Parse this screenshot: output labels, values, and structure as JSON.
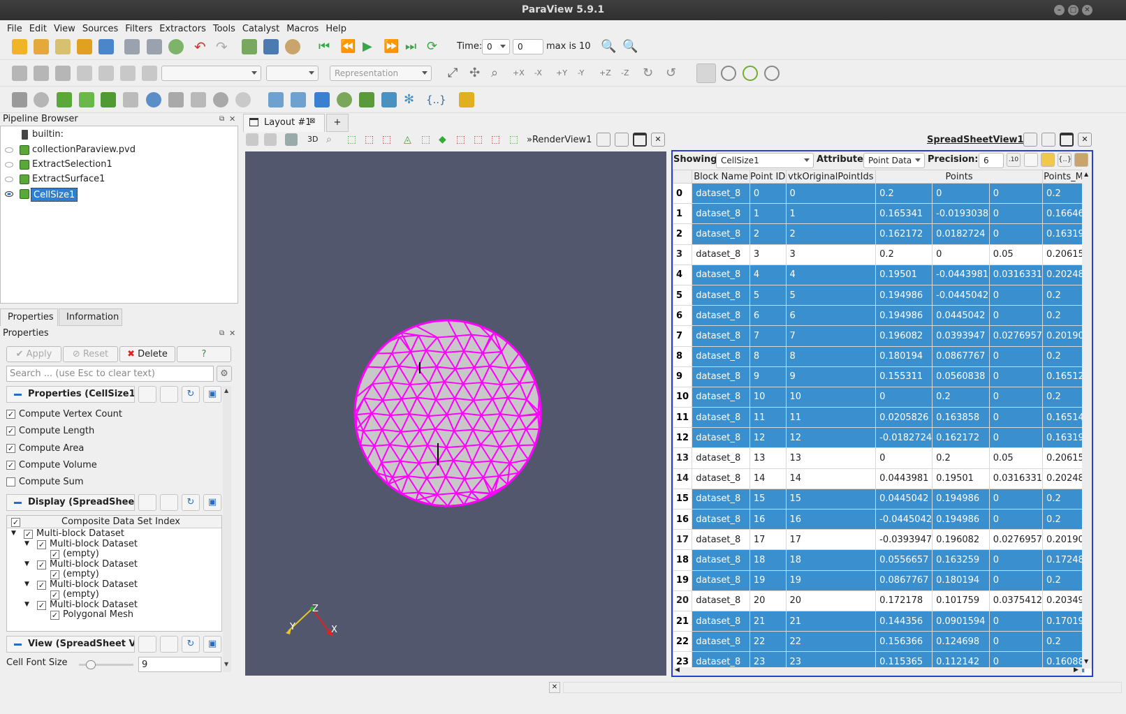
{
  "window": {
    "title": "ParaView 5.9.1"
  },
  "menu": [
    "File",
    "Edit",
    "View",
    "Sources",
    "Filters",
    "Extractors",
    "Tools",
    "Catalyst",
    "Macros",
    "Help"
  ],
  "time": {
    "label": "Time:",
    "value": "0",
    "index": "0",
    "max": "max is 10"
  },
  "toolbar2": {
    "representation": "Representation"
  },
  "pipeline": {
    "title": "Pipeline Browser",
    "items": [
      "builtin:",
      "collectionParaview.pvd",
      "ExtractSelection1",
      "ExtractSurface1",
      "CellSize1"
    ]
  },
  "tabs": {
    "properties": "Properties",
    "information": "Information"
  },
  "properties": {
    "header": "Properties",
    "apply": "Apply",
    "reset": "Reset",
    "delete": "Delete",
    "help": "?",
    "search_placeholder": "Search ... (use Esc to clear text)",
    "section1": "Properties (CellSize1)",
    "checks": [
      {
        "label": "Compute Vertex Count",
        "checked": true
      },
      {
        "label": "Compute Length",
        "checked": true
      },
      {
        "label": "Compute Area",
        "checked": true
      },
      {
        "label": "Compute Volume",
        "checked": true
      },
      {
        "label": "Compute Sum",
        "checked": false
      }
    ],
    "section2": "Display (SpreadSheet",
    "tree_header": "Composite Data Set Index",
    "tree": [
      "Multi-block Dataset",
      "Multi-block Dataset",
      "(empty)",
      "Multi-block Dataset",
      "(empty)",
      "Multi-block Dataset",
      "(empty)",
      "Multi-block Dataset",
      "Polygonal Mesh"
    ],
    "section3": "View (SpreadSheet Vi",
    "font_size_label": "Cell Font Size",
    "font_size_value": "9",
    "font_slider_fraction": 0.15
  },
  "layout": {
    "tab": "Layout #1",
    "add": "+",
    "render_view": "RenderView1",
    "mode3d": "3D",
    "spreadsheet_view": "SpreadSheetView1"
  },
  "spreadsheet": {
    "showing_label": "Showing",
    "showing_value": "CellSize1",
    "attribute_label": "Attribute:",
    "attribute_value": "Point Data",
    "precision_label": "Precision:",
    "precision_value": "6",
    "columns": [
      "Block Name",
      "Point ID",
      "vtkOriginalPointIds",
      "Points",
      "Points_M"
    ],
    "rows": [
      [
        "0",
        "dataset_8",
        "0",
        "0",
        "0.2",
        "0",
        "0",
        "0.2",
        true
      ],
      [
        "1",
        "dataset_8",
        "1",
        "1",
        "0.165341",
        "-0.0193038",
        "0",
        "0.16646",
        true
      ],
      [
        "2",
        "dataset_8",
        "2",
        "2",
        "0.162172",
        "0.0182724",
        "0",
        "0.16319",
        true
      ],
      [
        "3",
        "dataset_8",
        "3",
        "3",
        "0.2",
        "0",
        "0.05",
        "0.20615",
        false
      ],
      [
        "4",
        "dataset_8",
        "4",
        "4",
        "0.19501",
        "-0.0443981",
        "0.0316331",
        "0.20248",
        true
      ],
      [
        "5",
        "dataset_8",
        "5",
        "5",
        "0.194986",
        "-0.0445042",
        "0",
        "0.2",
        true
      ],
      [
        "6",
        "dataset_8",
        "6",
        "6",
        "0.194986",
        "0.0445042",
        "0",
        "0.2",
        true
      ],
      [
        "7",
        "dataset_8",
        "7",
        "7",
        "0.196082",
        "0.0393947",
        "0.0276957",
        "0.20190",
        true
      ],
      [
        "8",
        "dataset_8",
        "8",
        "8",
        "0.180194",
        "0.0867767",
        "0",
        "0.2",
        true
      ],
      [
        "9",
        "dataset_8",
        "9",
        "9",
        "0.155311",
        "0.0560838",
        "0",
        "0.16512",
        true
      ],
      [
        "10",
        "dataset_8",
        "10",
        "10",
        "0",
        "0.2",
        "0",
        "0.2",
        true
      ],
      [
        "11",
        "dataset_8",
        "11",
        "11",
        "0.0205826",
        "0.163858",
        "0",
        "0.16514",
        true
      ],
      [
        "12",
        "dataset_8",
        "12",
        "12",
        "-0.0182724",
        "0.162172",
        "0",
        "0.16319",
        true
      ],
      [
        "13",
        "dataset_8",
        "13",
        "13",
        "0",
        "0.2",
        "0.05",
        "0.20615",
        false
      ],
      [
        "14",
        "dataset_8",
        "14",
        "14",
        "0.0443981",
        "0.19501",
        "0.0316331",
        "0.20248",
        false
      ],
      [
        "15",
        "dataset_8",
        "15",
        "15",
        "0.0445042",
        "0.194986",
        "0",
        "0.2",
        true
      ],
      [
        "16",
        "dataset_8",
        "16",
        "16",
        "-0.0445042",
        "0.194986",
        "0",
        "0.2",
        true
      ],
      [
        "17",
        "dataset_8",
        "17",
        "17",
        "-0.0393947",
        "0.196082",
        "0.0276957",
        "0.20190",
        false
      ],
      [
        "18",
        "dataset_8",
        "18",
        "18",
        "0.0556657",
        "0.163259",
        "0",
        "0.17248",
        true
      ],
      [
        "19",
        "dataset_8",
        "19",
        "19",
        "0.0867767",
        "0.180194",
        "0",
        "0.2",
        true
      ],
      [
        "20",
        "dataset_8",
        "20",
        "20",
        "0.172178",
        "0.101759",
        "0.0375412",
        "0.20349",
        false
      ],
      [
        "21",
        "dataset_8",
        "21",
        "21",
        "0.144356",
        "0.0901594",
        "0",
        "0.17019",
        true
      ],
      [
        "22",
        "dataset_8",
        "22",
        "22",
        "0.156366",
        "0.124698",
        "0",
        "0.2",
        true
      ],
      [
        "23",
        "dataset_8",
        "23",
        "23",
        "0.115365",
        "0.112142",
        "0",
        "0.16088",
        true
      ]
    ]
  },
  "axes": {
    "z": "Z",
    "y": "Y",
    "x": "X"
  }
}
